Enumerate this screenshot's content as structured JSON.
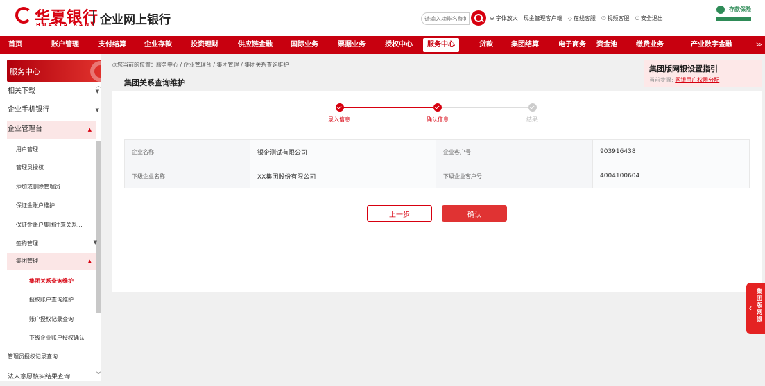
{
  "brand": {
    "name_cn": "华夏银行",
    "name_en": "HUAXIA BANK",
    "site_title": "企业网上银行",
    "partner_name": "存款保险",
    "brand_color": "#d7000f"
  },
  "top": {
    "search_placeholder": "请输入功能名称搜索",
    "links": [
      "字体放大",
      "现金管理客户端",
      "在线客服",
      "视频客服",
      "安全退出"
    ]
  },
  "nav": [
    "首页",
    "账户管理",
    "支付结算",
    "企业存款",
    "投资理财",
    "供应链金融",
    "国际业务",
    "票据业务",
    "授权中心",
    "服务中心",
    "贷款",
    "集团结算",
    "电子商务",
    "资金池",
    "缴费业务",
    "产业数字金融"
  ],
  "nav_active": "服务中心",
  "sidebar": {
    "header": "服务中心",
    "items": [
      {
        "label": "相关下载"
      },
      {
        "label": "企业手机银行"
      },
      {
        "label": "企业管理台"
      },
      {
        "label": "用户管理"
      },
      {
        "label": "管理员授权"
      },
      {
        "label": "添加或删除管理员"
      },
      {
        "label": "保证金账户维护"
      },
      {
        "label": "保证金账户集团往来关系..."
      },
      {
        "label": "签约管理"
      },
      {
        "label": "集团管理"
      },
      {
        "label": "集团关系查询维护"
      },
      {
        "label": "授权账户查询维护"
      },
      {
        "label": "账户授权记录查询"
      },
      {
        "label": "下级企业账户授权确认"
      },
      {
        "label": "管理员授权记录查询"
      },
      {
        "label": "法人意愿核实结果查询"
      }
    ]
  },
  "breadcrumb": "您当前的位置：服务中心 / 企业管理台 / 集团管理 / 集团关系查询维护",
  "page_title": "集团关系查询维护",
  "guide": {
    "title": "集团版网银设置指引",
    "step_label": "当前步骤:",
    "step_value": "网银用户权限分配"
  },
  "steps": [
    {
      "label": "录入信息",
      "done": true
    },
    {
      "label": "确认信息",
      "done": true
    },
    {
      "label": "结果",
      "done": false
    }
  ],
  "info": [
    {
      "label1": "企业名称",
      "value1": "银企测试有限公司",
      "label2": "企业客户号",
      "value2": "903916438"
    },
    {
      "label1": "下级企业名称",
      "value1": "XX集团股份有限公司",
      "label2": "下级企业客户号",
      "value2": "4004100604"
    }
  ],
  "buttons": {
    "prev": "上一步",
    "confirm": "确认"
  },
  "float_tab": "集团版网银"
}
